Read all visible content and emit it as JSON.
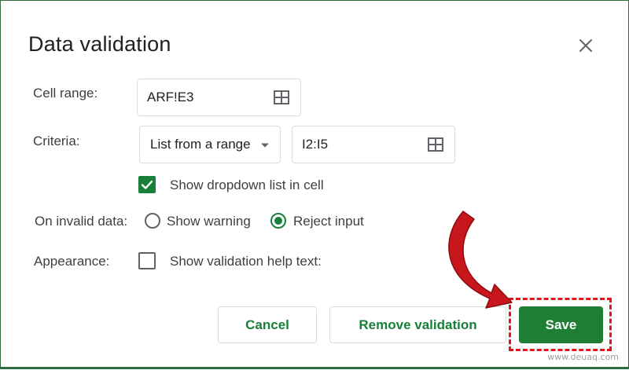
{
  "dialog": {
    "title": "Data validation",
    "cell_range": {
      "label": "Cell range:",
      "value": "ARF!E3"
    },
    "criteria": {
      "label": "Criteria:",
      "type_selected": "List from a range",
      "range_value": "I2:I5"
    },
    "show_dropdown": {
      "label": "Show dropdown list in cell",
      "checked": true
    },
    "invalid_data": {
      "label": "On invalid data:",
      "options": [
        "Show warning",
        "Reject input"
      ],
      "selected": "Reject input"
    },
    "appearance": {
      "label": "Appearance:",
      "help_text_label": "Show validation help text:",
      "checked": false
    },
    "buttons": {
      "cancel": "Cancel",
      "remove": "Remove validation",
      "save": "Save"
    }
  },
  "watermark": "www.deuaq.com",
  "colors": {
    "accent_green": "#188038",
    "primary_button": "#1e7e34",
    "highlight_red": "#e3131b",
    "arrow_red": "#c8161d"
  },
  "icons": {
    "close": "close-icon",
    "range_picker": "grid-icon",
    "dropdown": "caret-down-icon",
    "check": "check-icon"
  }
}
